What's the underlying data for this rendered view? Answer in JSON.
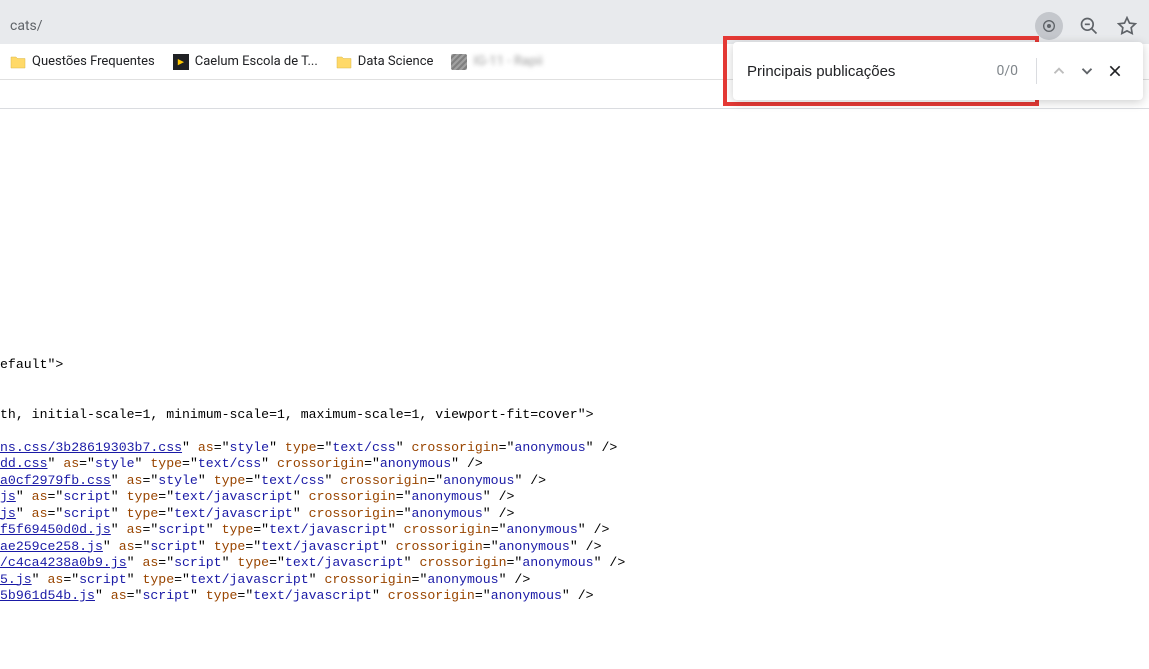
{
  "address": {
    "url": "cats/"
  },
  "toolbar_icons": {
    "lens": "lens-search-icon",
    "zoom_out": "zoom-out-icon",
    "star": "star-icon"
  },
  "bookmarks": [
    {
      "type": "folder",
      "label": "Questões Frequentes"
    },
    {
      "type": "caelum",
      "label": "Caelum Escola de T..."
    },
    {
      "type": "folder",
      "label": "Data Science"
    },
    {
      "type": "blurred",
      "label": "IG-11 - Rapii"
    }
  ],
  "find": {
    "query": "Principais publicações",
    "count": "0/0"
  },
  "source": {
    "line_default": "efault\">",
    "line_viewport": "th, initial-scale=1, minimum-scale=1, maximum-scale=1, viewport-fit=cover\">",
    "rows": [
      {
        "href": "ns.css/3b28619303b7.css",
        "as": "style",
        "type": "text/css",
        "cross": "anonymous"
      },
      {
        "href": "dd.css",
        "as": "style",
        "type": "text/css",
        "cross": "anonymous"
      },
      {
        "href": "a0cf2979fb.css",
        "as": "style",
        "type": "text/css",
        "cross": "anonymous"
      },
      {
        "href": "js",
        "as": "script",
        "type": "text/javascript",
        "cross": "anonymous"
      },
      {
        "href": "js",
        "as": "script",
        "type": "text/javascript",
        "cross": "anonymous"
      },
      {
        "href": "f5f69450d0d.js",
        "as": "script",
        "type": "text/javascript",
        "cross": "anonymous"
      },
      {
        "href": "ae259ce258.js",
        "as": "script",
        "type": "text/javascript",
        "cross": "anonymous"
      },
      {
        "href": "/c4ca4238a0b9.js",
        "as": "script",
        "type": "text/javascript",
        "cross": "anonymous"
      },
      {
        "href": "5.js",
        "as": "script",
        "type": "text/javascript",
        "cross": "anonymous"
      },
      {
        "href": "5b961d54b.js",
        "as": "script",
        "type": "text/javascript",
        "cross": "anonymous"
      }
    ]
  }
}
